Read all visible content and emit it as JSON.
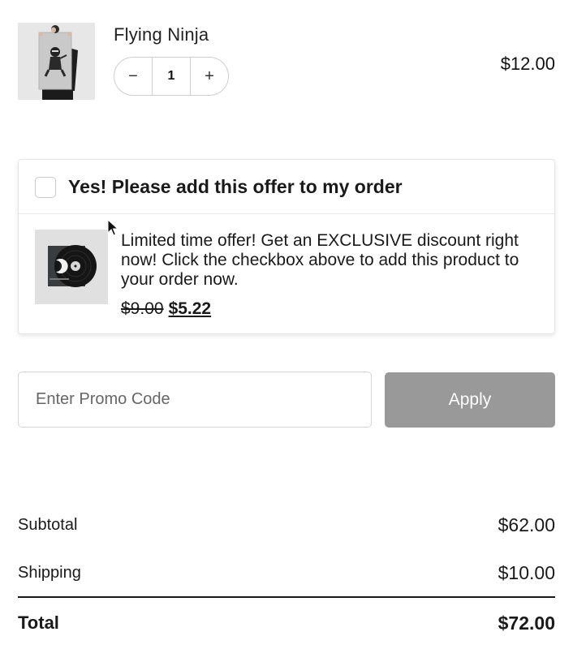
{
  "cart_item": {
    "name": "Flying Ninja",
    "quantity": "1",
    "decrement_symbol": "−",
    "increment_symbol": "+",
    "price": "$12.00"
  },
  "offer": {
    "title": "Yes! Please add this offer to my order",
    "checked": false,
    "description": "Limited time offer! Get an EXCLUSIVE discount right now! Click the checkbox above to add this product to your order now.",
    "old_price": "$9.00",
    "new_price": "$5.22"
  },
  "promo": {
    "placeholder": "Enter Promo Code",
    "apply_label": "Apply"
  },
  "totals": {
    "subtotal_label": "Subtotal",
    "subtotal_value": "$62.00",
    "shipping_label": "Shipping",
    "shipping_value": "$10.00",
    "total_label": "Total",
    "total_value": "$72.00"
  },
  "colors": {
    "apply_button_bg": "#999999",
    "divider": "#1a1a1a",
    "border": "#d6d6d6"
  }
}
